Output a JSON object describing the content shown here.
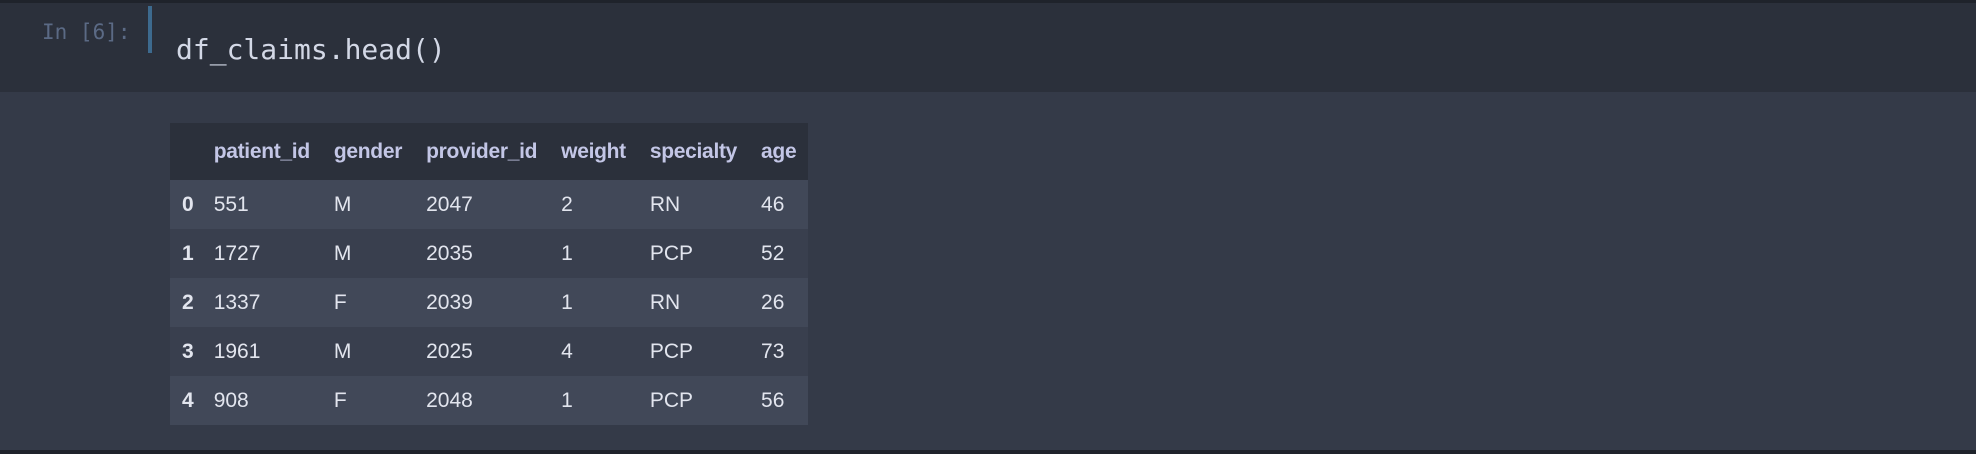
{
  "cell": {
    "prompt": "In [6]:",
    "code": "df_claims.head()"
  },
  "table": {
    "columns": [
      "",
      "patient_id",
      "gender",
      "provider_id",
      "weight",
      "specialty",
      "age"
    ],
    "rows": [
      [
        "0",
        "551",
        "M",
        "2047",
        "2",
        "RN",
        "46"
      ],
      [
        "1",
        "1727",
        "M",
        "2035",
        "1",
        "PCP",
        "52"
      ],
      [
        "2",
        "1337",
        "F",
        "2039",
        "1",
        "RN",
        "26"
      ],
      [
        "3",
        "1961",
        "M",
        "2025",
        "4",
        "PCP",
        "73"
      ],
      [
        "4",
        "908",
        "F",
        "2048",
        "1",
        "PCP",
        "56"
      ]
    ]
  }
}
